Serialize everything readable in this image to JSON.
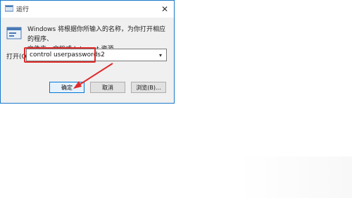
{
  "window": {
    "title": "运行",
    "close_symbol": "✕"
  },
  "description": {
    "line1": "Windows 将根据你所输入的名称，为你打开相应的程序、",
    "line2": "文件夹、文档或 Internet 资源。"
  },
  "open": {
    "label": "打开(O):",
    "value": "control userpasswords2"
  },
  "buttons": {
    "ok": "确定",
    "cancel": "取消",
    "browse": "浏览(B)..."
  },
  "colors": {
    "highlight": "#e02b2b",
    "arrow": "#e02b2b",
    "border": "#1979ca"
  },
  "icons": {
    "title": "run-icon",
    "main": "run-program-icon",
    "dropdown": "chevron-down-icon"
  }
}
